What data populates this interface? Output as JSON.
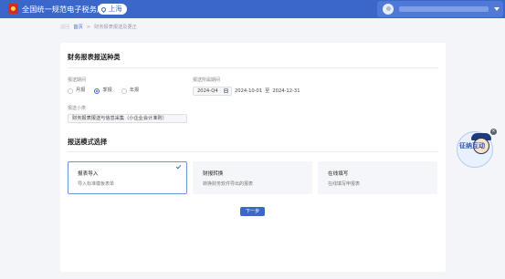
{
  "header": {
    "site_title": "全国统一规范电子税务局",
    "location": "上海",
    "colors": {
      "bar": "#3a67c9",
      "logo": "#d22d25"
    }
  },
  "breadcrumb": {
    "back": "返回",
    "home": "首页",
    "separator": ">",
    "current": "财务报表报送及更正"
  },
  "report_type": {
    "title": "财务报表报送种类",
    "period_label": "报送期间",
    "period_options": [
      "月报",
      "季报",
      "年报"
    ],
    "period_selected": "季报",
    "belong_label": "报送所属期间",
    "belong_value": "2024-Q4",
    "range_start": "2024-10-01",
    "range_to": "至",
    "range_end": "2024-12-31",
    "subtype_label": "报送小类",
    "subtype_value": "财务报表报送与信息采集（小企业会计准则）"
  },
  "mode_select": {
    "title": "报送模式选择",
    "options": [
      {
        "title": "报表导入",
        "desc": "导入标准模板表单",
        "selected": true
      },
      {
        "title": "财报转换",
        "desc": "转换财务软件导出的报表",
        "selected": false
      },
      {
        "title": "在线填写",
        "desc": "在线填写申报表",
        "selected": false
      }
    ]
  },
  "next_button": "下一步",
  "mascot": {
    "text": "征纳互动",
    "close": "×"
  },
  "icons": [
    "logo-icon",
    "location-pin-icon",
    "avatar-icon",
    "chevron-down-icon",
    "calendar-icon",
    "check-icon",
    "close-icon"
  ]
}
